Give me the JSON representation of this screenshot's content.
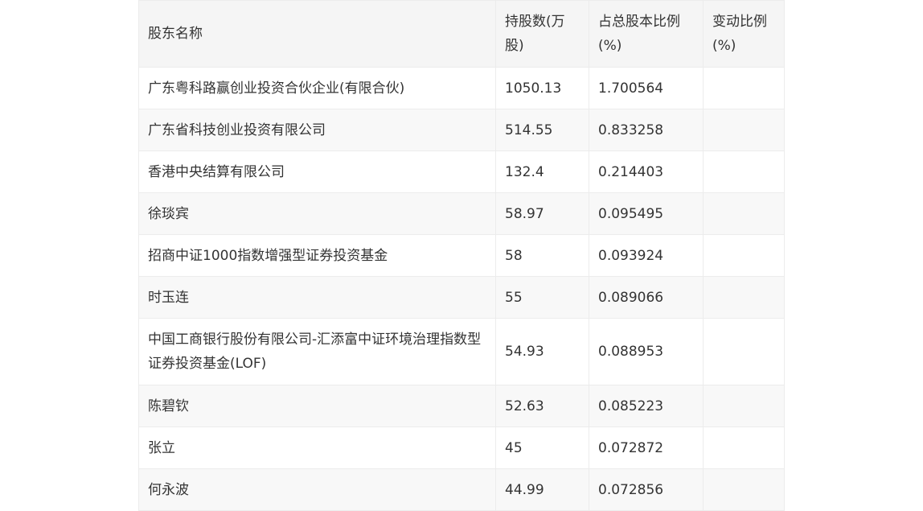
{
  "table": {
    "headers": [
      "股东名称",
      "持股数(万股)",
      "占总股本比例(%)",
      "变动比例(%)"
    ],
    "rows": [
      {
        "name": "广东粤科路赢创业投资合伙企业(有限合伙)",
        "shares": "1050.13",
        "ratio": "1.700564",
        "change": ""
      },
      {
        "name": "广东省科技创业投资有限公司",
        "shares": "514.55",
        "ratio": "0.833258",
        "change": ""
      },
      {
        "name": "香港中央结算有限公司",
        "shares": "132.4",
        "ratio": "0.214403",
        "change": ""
      },
      {
        "name": "徐琰宾",
        "shares": "58.97",
        "ratio": "0.095495",
        "change": ""
      },
      {
        "name": "招商中证1000指数增强型证券投资基金",
        "shares": "58",
        "ratio": "0.093924",
        "change": ""
      },
      {
        "name": "时玉连",
        "shares": "55",
        "ratio": "0.089066",
        "change": ""
      },
      {
        "name": "中国工商银行股份有限公司-汇添富中证环境治理指数型证券投资基金(LOF)",
        "shares": "54.93",
        "ratio": "0.088953",
        "change": ""
      },
      {
        "name": "陈碧钦",
        "shares": "52.63",
        "ratio": "0.085223",
        "change": ""
      },
      {
        "name": "张立",
        "shares": "45",
        "ratio": "0.072872",
        "change": ""
      },
      {
        "name": "何永波",
        "shares": "44.99",
        "ratio": "0.072856",
        "change": ""
      }
    ]
  }
}
